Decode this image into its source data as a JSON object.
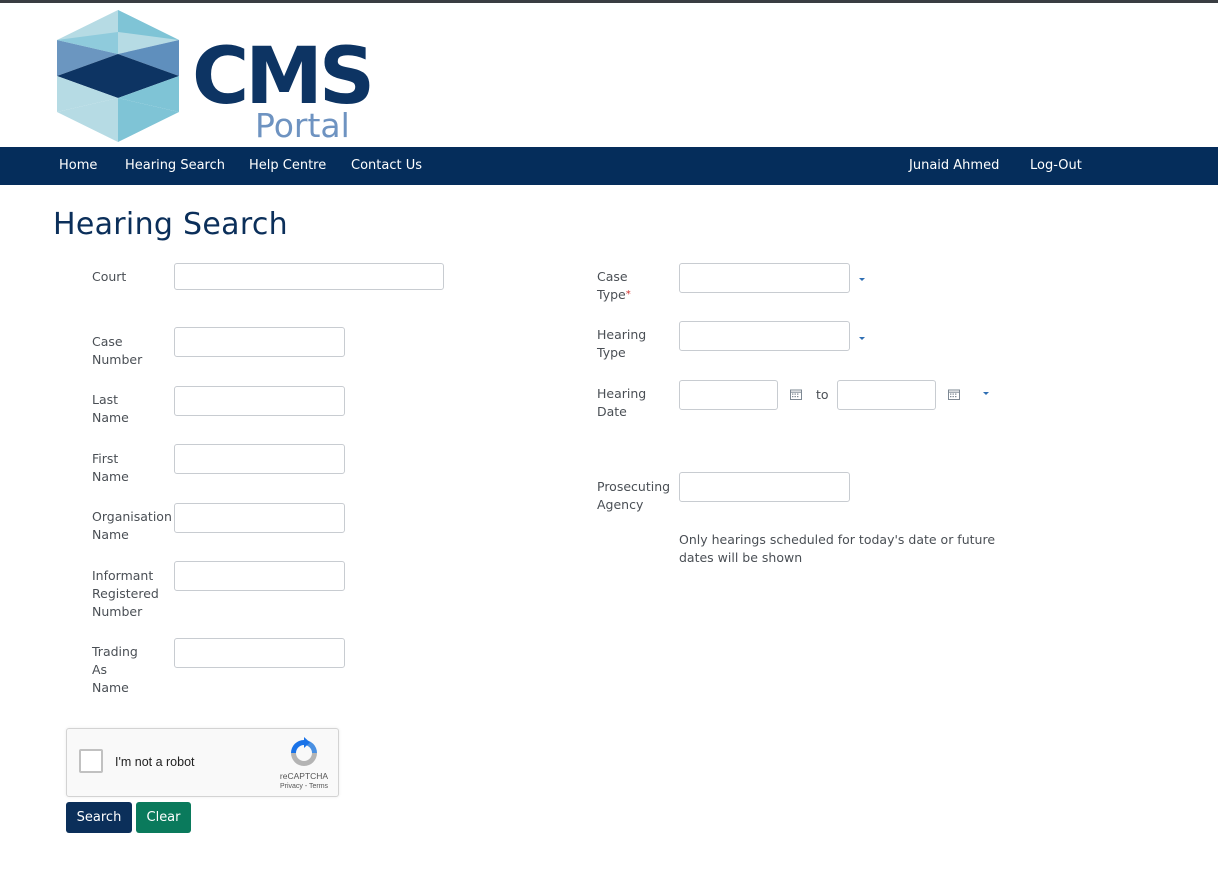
{
  "logo": {
    "title": "CMS",
    "subtitle": "Portal"
  },
  "nav": {
    "home": "Home",
    "hearing_search": "Hearing Search",
    "help_centre": "Help Centre",
    "contact_us": "Contact Us",
    "user_name": "Junaid Ahmed",
    "logout": "Log-Out"
  },
  "page": {
    "title": "Hearing Search"
  },
  "form": {
    "court_label": "Court",
    "case_number_label_1": "Case",
    "case_number_label_2": "Number",
    "last_name_label_1": "Last",
    "last_name_label_2": "Name",
    "first_name_label_1": "First",
    "first_name_label_2": "Name",
    "organisation_label_1": "Organisation",
    "organisation_label_2": "Name",
    "informant_label_1": "Informant",
    "informant_label_2": "Registered",
    "informant_label_3": "Number",
    "trading_label_1": "Trading",
    "trading_label_2": "As",
    "trading_label_3": "Name",
    "case_type_label_1": "Case",
    "case_type_label_2": "Type",
    "required_mark": "*",
    "hearing_type_label_1": "Hearing",
    "hearing_type_label_2": "Type",
    "hearing_date_label_1": "Hearing",
    "hearing_date_label_2": "Date",
    "date_to": "to",
    "prosecuting_label_1": "Prosecuting",
    "prosecuting_label_2": "Agency",
    "note": "Only hearings scheduled for today's date or future dates will be shown",
    "values": {
      "court": "",
      "case_number": "",
      "last_name": "",
      "first_name": "",
      "organisation": "",
      "informant": "",
      "trading": "",
      "case_type": "",
      "hearing_type": "",
      "date_from": "",
      "date_to": "",
      "prosecuting": ""
    }
  },
  "captcha": {
    "label": "I'm not a robot",
    "brand": "reCAPTCHA",
    "links": "Privacy - Terms",
    "checked": false
  },
  "buttons": {
    "search": "Search",
    "clear": "Clear"
  },
  "colors": {
    "navy": "#052d5b",
    "search_button": "#0b2f5a",
    "clear_button": "#0a7a5c",
    "required": "#d0312d"
  },
  "icons": {
    "dropdown": "caret-down-icon",
    "calendar": "calendar-icon",
    "recaptcha": "recaptcha-logo-icon"
  }
}
